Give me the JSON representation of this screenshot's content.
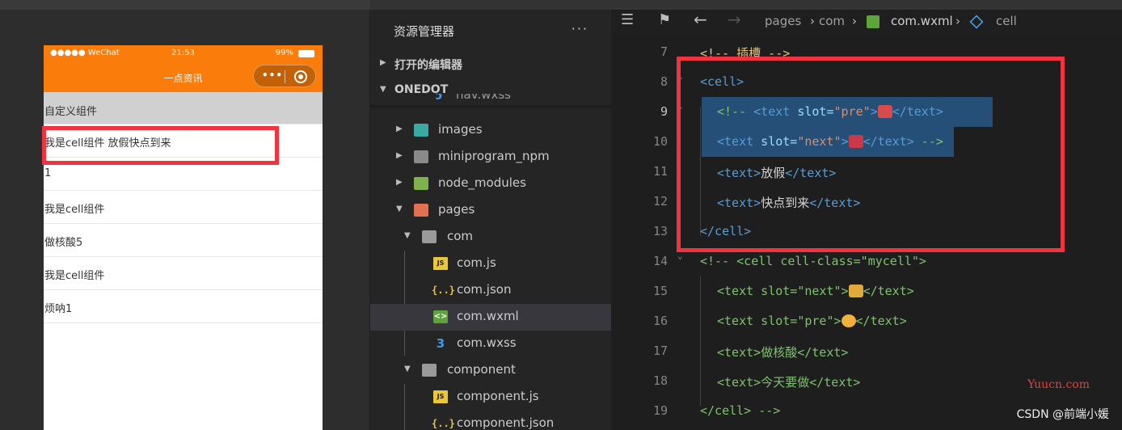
{
  "simulator": {
    "status_signal": "●●●●● WeChat",
    "status_time": "21:53",
    "status_battery": "99%",
    "nav_title": "一点资讯",
    "capsule_dots": "•••",
    "header": "自定义组件",
    "rows": [
      "我是cell组件 放假快点到来",
      "1",
      "我是cell组件",
      "做核酸5",
      "我是cell组件",
      "烦呐1"
    ]
  },
  "explorer": {
    "title": "资源管理器",
    "more": "···",
    "open_editors": "打开的编辑器",
    "project": "ONEDOT",
    "items": [
      {
        "label": "nav.wxss"
      },
      {
        "label": "images"
      },
      {
        "label": "miniprogram_npm"
      },
      {
        "label": "node_modules"
      },
      {
        "label": "pages"
      },
      {
        "label": "com"
      },
      {
        "label": "com.js"
      },
      {
        "label": "com.json"
      },
      {
        "label": "com.wxml"
      },
      {
        "label": "com.wxss"
      },
      {
        "label": "component"
      },
      {
        "label": "component.js"
      },
      {
        "label": "component.json"
      }
    ]
  },
  "editor": {
    "breadcrumb": [
      "pages",
      "com",
      "com.wxml",
      "cell"
    ],
    "lines": {
      "n7": "7",
      "n8": "8",
      "n9": "9",
      "n10": "10",
      "n11": "11",
      "n12": "12",
      "n13": "13",
      "n14": "14",
      "n15": "15",
      "n16": "16",
      "n17": "17",
      "n18": "18",
      "n19": "19",
      "l7": "<!-- 插槽 -->",
      "l8": "<cell>",
      "l9a": "<!-- ",
      "l9b": "<text",
      "l9c": " slot=",
      "l9d": "\"pre\"",
      "l9e": ">",
      "l9f": "</text>",
      "l10a": "<text",
      "l10b": " slot=",
      "l10c": "\"next\"",
      "l10d": ">",
      "l10e": "</text>",
      "l10f": " -->",
      "l11a": "<text>",
      "l11b": "放假",
      "l11c": "</text>",
      "l12a": "<text>",
      "l12b": "快点到来",
      "l12c": "</text>",
      "l13": "</cell>",
      "l14a": "<!-- <cell cell-class=\"mycell\">",
      "l15a": "<text slot=\"next\">",
      "l15b": "</text>",
      "l16a": "<text slot=\"pre\">",
      "l16b": "</text>",
      "l17a": "<text>",
      "l17b": "做核酸",
      "l17c": "</text>",
      "l18a": "<text>",
      "l18b": "今天要做",
      "l18c": "</text>",
      "l19": "</cell> -->"
    }
  },
  "watermark": {
    "site": "Yuucn.com",
    "author": "CSDN @前端小媛"
  },
  "colors": {
    "accent_orange": "#fa7d0b",
    "highlight_red": "#f0333f"
  }
}
